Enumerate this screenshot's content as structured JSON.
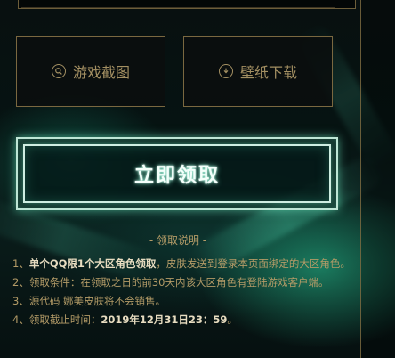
{
  "buttons": {
    "screenshots_label": "游戏截图",
    "wallpaper_label": "壁纸下载",
    "claim_label": "立即领取"
  },
  "icons": {
    "screenshots": "search-icon",
    "wallpaper": "download-icon"
  },
  "rules": {
    "title": "- 领取说明 -",
    "item1_prefix": "1、",
    "item1_bold": "单个QQ限1个大区角色领取",
    "item1_rest": "，皮肤发送到登录本页面绑定的大区角色。",
    "item2": "2、领取条件：在领取之日的前30天内该大区角色有登陆游戏客户端。",
    "item3": "3、源代码 娜美皮肤将不会销售。",
    "item4_prefix": "4、领取截止时间：",
    "item4_bold": "2019年12月31日23：59",
    "item4_suffix": "。"
  },
  "colors": {
    "gold": "#b39b67",
    "glow": "#bfe6d6",
    "background": "#050b0b"
  }
}
